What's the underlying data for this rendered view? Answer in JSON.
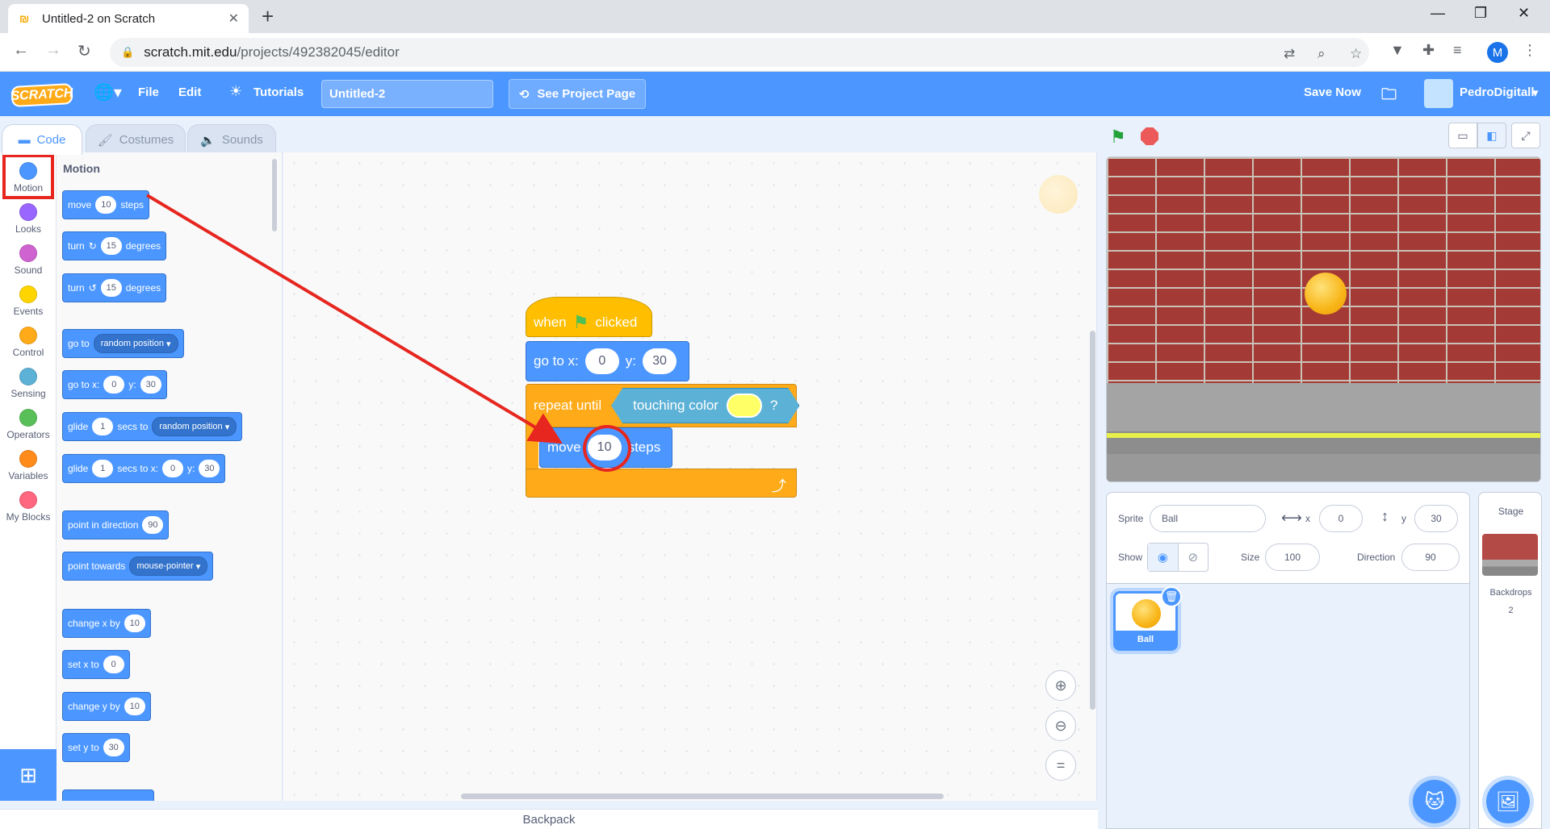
{
  "browser": {
    "tab_title": "Untitled-2 on Scratch",
    "url_host": "scratch.mit.edu",
    "url_path": "/projects/492382045/editor",
    "profile_initial": "M"
  },
  "menu": {
    "logo": "SCRATCH",
    "file": "File",
    "edit": "Edit",
    "tutorials": "Tutorials",
    "project_title": "Untitled-2",
    "see_project_page": "See Project Page",
    "save_now": "Save Now",
    "username": "PedroDigitall"
  },
  "editor_tabs": {
    "code": "Code",
    "costumes": "Costumes",
    "sounds": "Sounds"
  },
  "categories": [
    {
      "label": "Motion",
      "color": "#4c97ff"
    },
    {
      "label": "Looks",
      "color": "#9966ff"
    },
    {
      "label": "Sound",
      "color": "#cf63cf"
    },
    {
      "label": "Events",
      "color": "#ffd500"
    },
    {
      "label": "Control",
      "color": "#ffab19"
    },
    {
      "label": "Sensing",
      "color": "#5cb1d6"
    },
    {
      "label": "Operators",
      "color": "#59c059"
    },
    {
      "label": "Variables",
      "color": "#ff8c1a"
    },
    {
      "label": "My Blocks",
      "color": "#ff6680"
    }
  ],
  "palette": {
    "title": "Motion",
    "move": {
      "a": "move",
      "v": "10",
      "b": "steps"
    },
    "turn_cw": {
      "a": "turn",
      "v": "15",
      "b": "degrees"
    },
    "turn_ccw": {
      "a": "turn",
      "v": "15",
      "b": "degrees"
    },
    "goto": {
      "a": "go to",
      "dd": "random position"
    },
    "gotoxy": {
      "a": "go to x:",
      "x": "0",
      "b": "y:",
      "y": "30"
    },
    "glide1": {
      "a": "glide",
      "v": "1",
      "b": "secs to",
      "dd": "random position"
    },
    "glide2": {
      "a": "glide",
      "v": "1",
      "b": "secs to x:",
      "x": "0",
      "c": "y:",
      "y": "30"
    },
    "point_dir": {
      "a": "point in direction",
      "v": "90"
    },
    "point_towards": {
      "a": "point towards",
      "dd": "mouse-pointer"
    },
    "change_x": {
      "a": "change x by",
      "v": "10"
    },
    "set_x": {
      "a": "set x to",
      "v": "0"
    },
    "change_y": {
      "a": "change y by",
      "v": "10"
    },
    "set_y": {
      "a": "set y to",
      "v": "30"
    }
  },
  "script": {
    "when": "when",
    "clicked": "clicked",
    "goto_label": "go to x:",
    "goto_x": "0",
    "goto_y_label": "y:",
    "goto_y": "30",
    "repeat_until": "repeat until",
    "touching_color": "touching color",
    "question": "?",
    "touch_color": "#ffff66",
    "move": "move",
    "move_value": "10",
    "steps": "steps"
  },
  "backpack": "Backpack",
  "sprite_info": {
    "sprite_label": "Sprite",
    "sprite_name": "Ball",
    "x_label": "x",
    "x": "0",
    "y_label": "y",
    "y": "30",
    "show_label": "Show",
    "size_label": "Size",
    "size": "100",
    "direction_label": "Direction",
    "direction": "90"
  },
  "sprites": [
    {
      "name": "Ball"
    }
  ],
  "stage_pane": {
    "title": "Stage",
    "backdrops_label": "Backdrops",
    "backdrops_count": "2"
  }
}
